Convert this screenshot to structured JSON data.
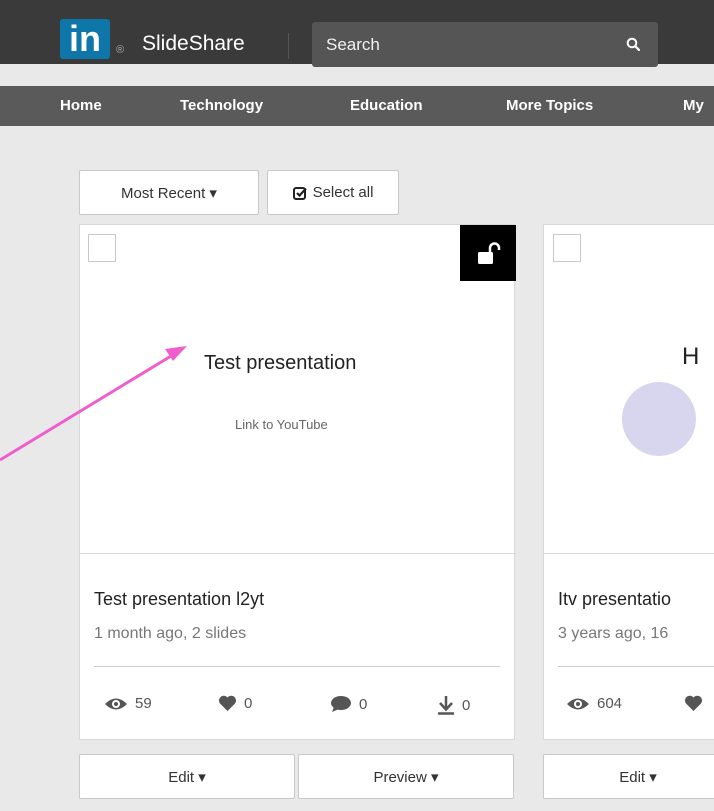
{
  "header": {
    "logo_mark": "in",
    "logo_registered": "®",
    "logo_text": "SlideShare",
    "search_placeholder": "Search"
  },
  "nav": {
    "items": [
      "Home",
      "Technology",
      "Education",
      "More Topics",
      "My"
    ]
  },
  "toolbar": {
    "sort_label": "Most Recent ▾",
    "select_all_label": "Select all"
  },
  "cards": [
    {
      "thumb_title": "Test presentation",
      "thumb_subtitle": "Link to YouTube",
      "title": "Test presentation l2yt",
      "meta": "1 month ago, 2 slides",
      "views": "59",
      "likes": "0",
      "comments": "0",
      "downloads": "0",
      "edit_label": "Edit ▾",
      "preview_label": "Preview ▾"
    },
    {
      "thumb_title": "H",
      "title": "Itv presentatio",
      "meta": "3 years ago, 16",
      "views": "604",
      "edit_label": "Edit ▾"
    }
  ],
  "colors": {
    "brand": "#0e76a8",
    "arrow": "#ee5fcd",
    "thumb_circle": "#d8d6ee"
  }
}
